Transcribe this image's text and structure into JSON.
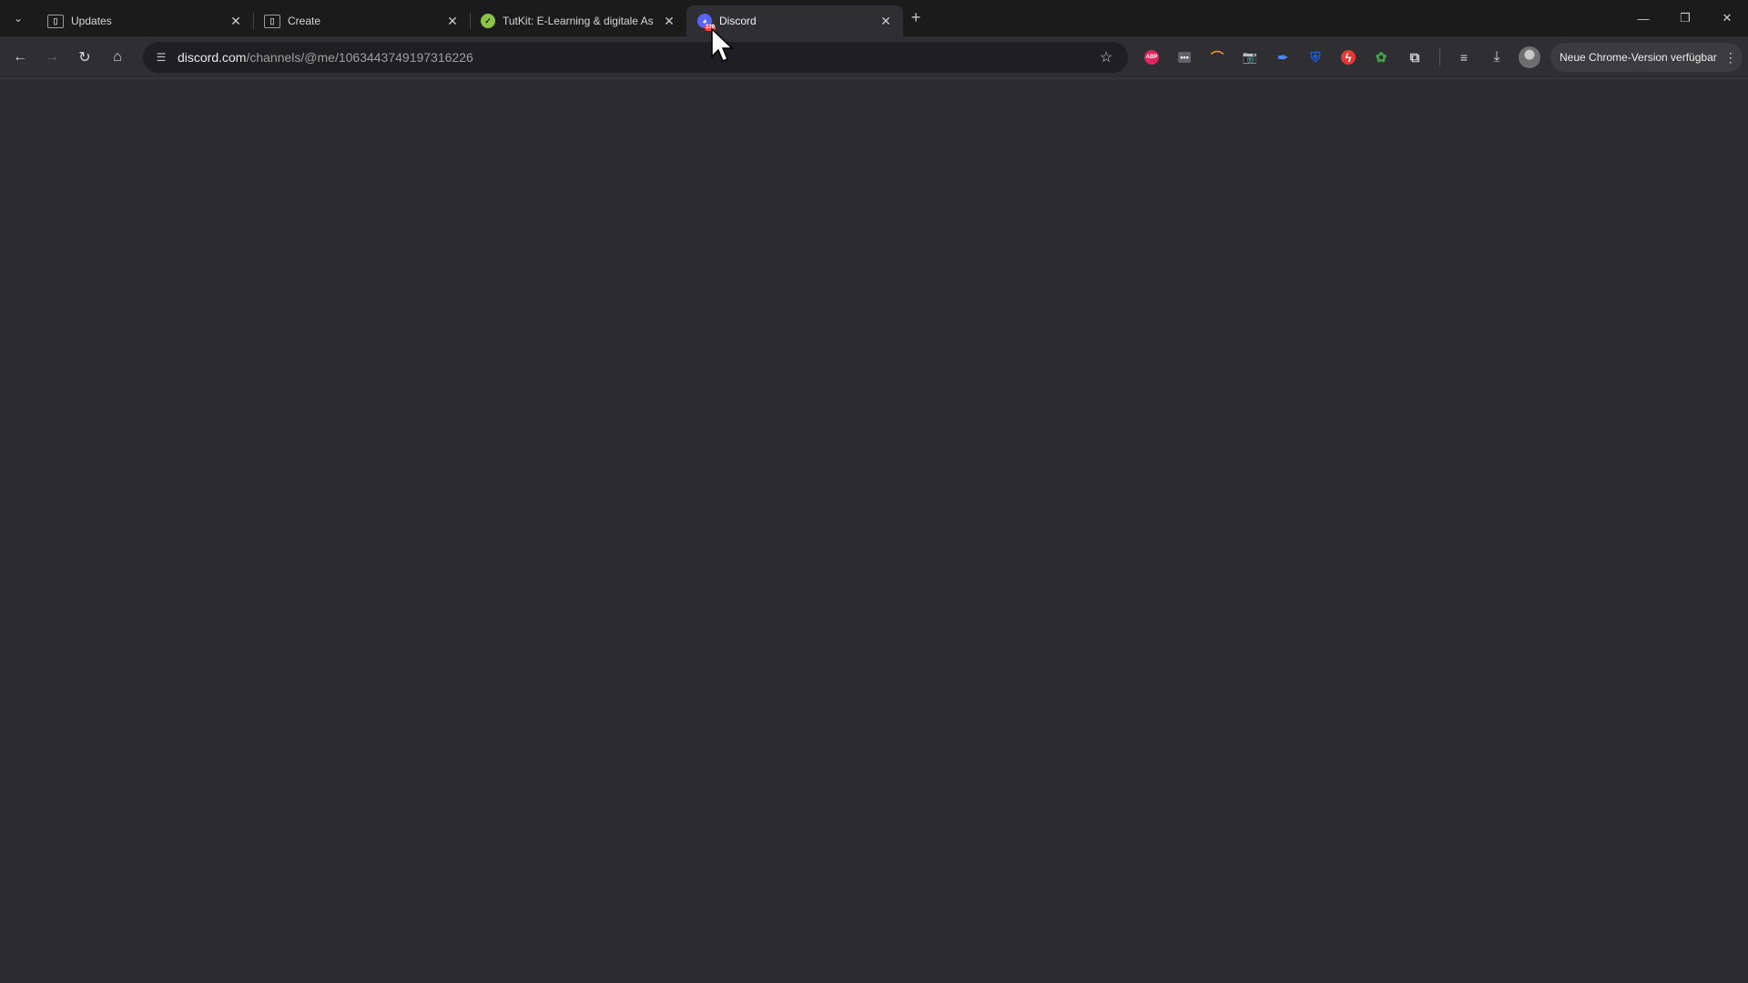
{
  "tabs": [
    {
      "title": "Updates",
      "favicon": "document-icon",
      "active": false
    },
    {
      "title": "Create",
      "favicon": "document-icon",
      "active": false
    },
    {
      "title": "TutKit: E-Learning & digitale As",
      "favicon": "tutkit-icon",
      "active": false
    },
    {
      "title": "Discord",
      "favicon": "discord-icon",
      "badge": "329",
      "active": true
    }
  ],
  "tab_close_glyph": "✕",
  "new_tab_glyph": "+",
  "window_controls": {
    "minimize": "—",
    "maximize": "❐",
    "close": "✕"
  },
  "toolbar": {
    "url_host": "discord.com",
    "url_path": "/channels/@me/1063443749197316226",
    "update_label": "Neue Chrome-Version verfügbar",
    "menu_glyph": "⋮"
  },
  "extensions": [
    {
      "name": "adblock-plus-icon",
      "glyph": "ABP",
      "color": "#e0245e"
    },
    {
      "name": "password-dots-icon",
      "glyph": "•••",
      "color": "#5f6368"
    },
    {
      "name": "rainbow-arc-icon",
      "glyph": "⌒",
      "color": "#f4a300"
    },
    {
      "name": "camera-icon",
      "glyph": "📷",
      "color": "#9aa0a6"
    },
    {
      "name": "pen-icon",
      "glyph": "✒",
      "color": "#4c8bf5"
    },
    {
      "name": "bitwarden-shield-icon",
      "glyph": "⛨",
      "color": "#175ddc"
    },
    {
      "name": "lightning-icon",
      "glyph": "ϟ",
      "color": "#e53935"
    },
    {
      "name": "leaf-icon",
      "glyph": "✿",
      "color": "#43a047"
    },
    {
      "name": "puzzle-icon",
      "glyph": "⧉",
      "color": "#d0d0d0"
    }
  ],
  "colors": {
    "page_background": "#2b2b30",
    "toolbar": "#2f2f33",
    "tabstrip": "#1b1b1b",
    "discord_brand": "#5865f2"
  }
}
